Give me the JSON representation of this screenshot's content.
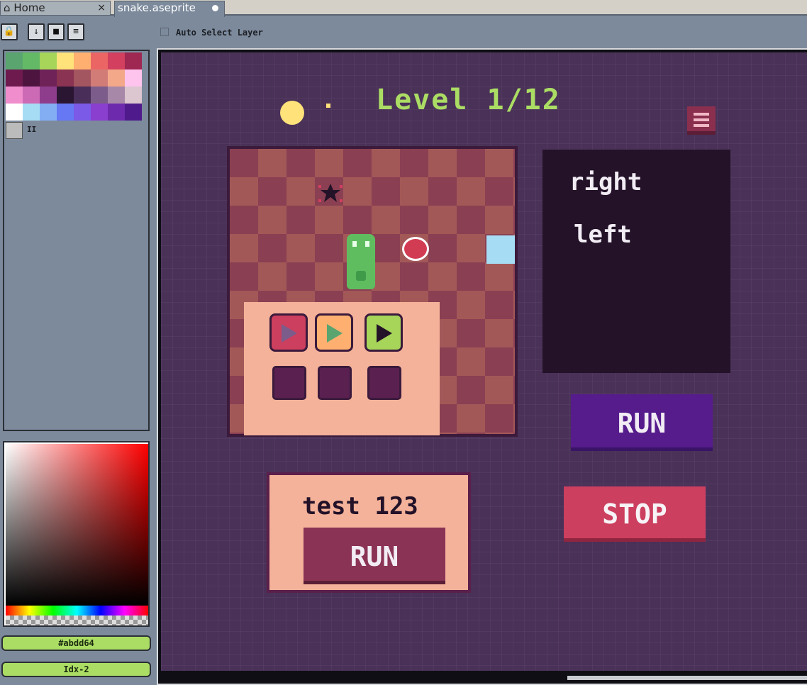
{
  "tabs": [
    {
      "label": "Home",
      "close": "×"
    },
    {
      "label": "snake.aseprite"
    }
  ],
  "toolbar": {
    "auto_select_label": "Auto Select Layer"
  },
  "palette": {
    "colors": [
      "#5aa56f",
      "#64b966",
      "#a6d55a",
      "#ffe27a",
      "#ffb070",
      "#ea6563",
      "#d23f5f",
      "#9e2851",
      "#6e1a4e",
      "#4e1440",
      "#6e2258",
      "#8a3352",
      "#a35560",
      "#d27c78",
      "#f4a88a",
      "#ffc4ee",
      "#f08dcc",
      "#cd6ab6",
      "#8e3d8c",
      "#2a1632",
      "#4a2e5a",
      "#7c5c8a",
      "#a888a8",
      "#dcc6d0",
      "#ffffff",
      "#a6dcf4",
      "#84aef4",
      "#6678f4",
      "#7c5ae8",
      "#8a3fce",
      "#6e2aac",
      "#4e1a8c"
    ],
    "mode_label": "II"
  },
  "color_picker": {
    "hex_value": "#abdd64",
    "index_value": "Idx-2"
  },
  "game": {
    "level_title": "Level 1/12",
    "log_lines": [
      "right",
      "left"
    ],
    "run_label": "RUN",
    "stop_label": "STOP",
    "test_label": "test 123",
    "test_run_label": "RUN",
    "command_buttons": [
      {
        "bg": "#cc3f5e",
        "arrow": "#7c5c8a"
      },
      {
        "bg": "#ffb070",
        "arrow": "#5aa56f"
      },
      {
        "bg": "#a6d55a",
        "arrow": "#231228"
      }
    ]
  }
}
